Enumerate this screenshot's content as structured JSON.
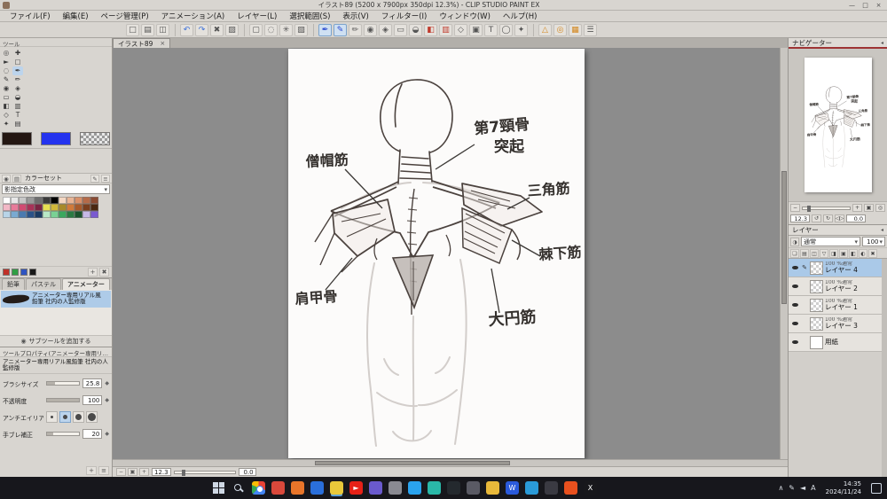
{
  "window": {
    "title": "イラスト89 (5200 x 7900px 350dpi 12.3%) - CLIP STUDIO PAINT EX",
    "minimize": "—",
    "maximize": "□",
    "close": "×"
  },
  "menubar": [
    "ファイル(F)",
    "編集(E)",
    "ページ管理(P)",
    "アニメーション(A)",
    "レイヤー(L)",
    "選択範囲(S)",
    "表示(V)",
    "フィルター(I)",
    "ウィンドウ(W)",
    "ヘルプ(H)"
  ],
  "toolbar": [
    {
      "name": "new-file-icon",
      "glyph": "□",
      "color": "#555555"
    },
    {
      "name": "open-file-icon",
      "glyph": "▤",
      "color": "#555555"
    },
    {
      "name": "save-icon",
      "glyph": "◫",
      "color": "#555555"
    },
    {
      "name": "sep"
    },
    {
      "name": "undo-icon",
      "glyph": "↶",
      "color": "#3a6fd8"
    },
    {
      "name": "redo-icon",
      "glyph": "↷",
      "color": "#3a6fd8"
    },
    {
      "name": "delete-icon",
      "glyph": "✖",
      "color": "#555555"
    },
    {
      "name": "fill-selection-icon",
      "glyph": "▨",
      "color": "#555555"
    },
    {
      "name": "sep"
    },
    {
      "name": "select-rectangle-icon",
      "glyph": "▢",
      "color": "#555555"
    },
    {
      "name": "select-lasso-icon",
      "glyph": "◌",
      "color": "#555555"
    },
    {
      "name": "auto-select-icon",
      "glyph": "✳",
      "color": "#555555"
    },
    {
      "name": "deselect-icon",
      "glyph": "▧",
      "color": "#555555"
    },
    {
      "name": "sep"
    },
    {
      "name": "pen-tool-icon",
      "glyph": "✒",
      "color": "#2a4ad0",
      "active": true
    },
    {
      "name": "pencil-tool-icon",
      "glyph": "✎",
      "color": "#2a4ad0",
      "active": true
    },
    {
      "name": "brush-tool-icon",
      "glyph": "✏",
      "color": "#555555"
    },
    {
      "name": "airbrush-tool-icon",
      "glyph": "◉",
      "color": "#555555"
    },
    {
      "name": "decoration-tool-icon",
      "glyph": "◈",
      "color": "#555555"
    },
    {
      "name": "eraser-tool-icon",
      "glyph": "▭",
      "color": "#555555"
    },
    {
      "name": "blend-tool-icon",
      "glyph": "◒",
      "color": "#555555"
    },
    {
      "name": "fill-tool-icon",
      "glyph": "◧",
      "color": "#c0392b"
    },
    {
      "name": "gradient-tool-icon",
      "glyph": "▥",
      "color": "#c0392b"
    },
    {
      "name": "figure-tool-icon",
      "glyph": "◇",
      "color": "#555555"
    },
    {
      "name": "frame-tool-icon",
      "glyph": "▣",
      "color": "#555555"
    },
    {
      "name": "text-tool-icon",
      "glyph": "T",
      "color": "#555555"
    },
    {
      "name": "balloon-tool-icon",
      "glyph": "◯",
      "color": "#555555"
    },
    {
      "name": "eyedropper-tool-icon",
      "glyph": "✦",
      "color": "#555555"
    },
    {
      "name": "sep"
    },
    {
      "name": "snap-ruler-icon",
      "glyph": "△",
      "color": "#d4881f"
    },
    {
      "name": "snap-special-ruler-icon",
      "glyph": "◎",
      "color": "#d4881f"
    },
    {
      "name": "grid-icon",
      "glyph": "▦",
      "color": "#d4881f"
    },
    {
      "name": "material-palette-icon",
      "glyph": "☰",
      "color": "#555555"
    }
  ],
  "tool_palette": {
    "title": "ツール",
    "tools": [
      {
        "name": "zoom-tool",
        "glyph": "◎"
      },
      {
        "name": "move-tool",
        "glyph": "✚"
      },
      {
        "name": "operation-tool",
        "glyph": "►"
      },
      {
        "name": "selection-tool",
        "glyph": "▢"
      },
      {
        "name": "lasso-tool",
        "glyph": "◌"
      },
      {
        "name": "pen-tool",
        "glyph": "✒",
        "active": true
      },
      {
        "name": "pencil-tool",
        "glyph": "✎"
      },
      {
        "name": "brush-tool",
        "glyph": "✏"
      },
      {
        "name": "airbrush-tool",
        "glyph": "◉"
      },
      {
        "name": "decoration-tool",
        "glyph": "◈"
      },
      {
        "name": "eraser-tool",
        "glyph": "▭"
      },
      {
        "name": "blend-tool",
        "glyph": "◒"
      },
      {
        "name": "fill-tool",
        "glyph": "◧"
      },
      {
        "name": "gradient-tool",
        "glyph": "▥"
      },
      {
        "name": "figure-tool",
        "glyph": "◇"
      },
      {
        "name": "text-tool",
        "glyph": "T"
      },
      {
        "name": "eyedropper-tool",
        "glyph": "✦"
      },
      {
        "name": "lighttable-tool",
        "glyph": "▤"
      }
    ]
  },
  "color_area": {
    "main_color": "#241712",
    "sub_color": "#2433ee"
  },
  "color_set": {
    "tab_label": "カラーセット",
    "preset_name": "影指定色改",
    "dropdown_arrow": "▾",
    "header_icons": [
      {
        "name": "color-wheel-tab-icon",
        "glyph": "◉"
      },
      {
        "name": "color-slider-tab-icon",
        "glyph": "▤"
      }
    ],
    "menu_icons": [
      {
        "name": "edit-colorset-icon",
        "glyph": "✎"
      },
      {
        "name": "colorset-menu-icon",
        "glyph": "≡"
      }
    ],
    "footer_icons": [
      {
        "name": "add-color-icon",
        "glyph": "+"
      },
      {
        "name": "delete-color-icon",
        "glyph": "✖"
      }
    ],
    "colors": [
      "#ffffff",
      "#e8e8e8",
      "#c8c8c8",
      "#9a9a9a",
      "#6e6e6e",
      "#3a3a3a",
      "#000000",
      "#f4d7c2",
      "#e8b495",
      "#d9906a",
      "#b56a48",
      "#8a4a32",
      "#f2b8c6",
      "#e87a9a",
      "#d14a72",
      "#a83258",
      "#7a2442",
      "#e8e052",
      "#d1b83a",
      "#a88a2a",
      "#d17a3a",
      "#a85a2a",
      "#7a3e1e",
      "#4a2812",
      "#b8d4e8",
      "#7aaad1",
      "#4a7ab0",
      "#2a5288",
      "#1a3a62",
      "#b8e8c6",
      "#7ad194",
      "#3aa85e",
      "#2a7a42",
      "#1a522c",
      "#c6b8e8",
      "#7a5ad1"
    ],
    "registered": [
      "#c03028",
      "#2f9e44",
      "#2f54c0",
      "#191919"
    ]
  },
  "subtool": {
    "tabs": [
      {
        "label": "鉛筆"
      },
      {
        "label": "パステル"
      },
      {
        "label": "アニメーター",
        "active": true
      }
    ],
    "items": [
      {
        "name": "アニメーター専用リアル風鉛筆 社内の人監修版",
        "selected": true
      }
    ],
    "add_icon": "◉",
    "add_label": "サブツールを追加する"
  },
  "tool_property": {
    "title": "ツールプロパティ(アニメーター専用リアル風鉛筆 社内の人監修版)",
    "brush_name": "アニメーター専用リアル風鉛筆 社内の人監修版",
    "props": [
      {
        "type": "slider",
        "label": "ブラシサイズ",
        "value": "25.8"
      },
      {
        "type": "slider",
        "label": "不透明度",
        "value": "100"
      },
      {
        "type": "aa",
        "label": "アンチエイリアス"
      },
      {
        "type": "slider",
        "label": "手ブレ補正",
        "value": "20"
      }
    ],
    "footer_icons": [
      {
        "name": "add-to-subtool-icon",
        "glyph": "+"
      },
      {
        "name": "property-settings-icon",
        "glyph": "≡"
      }
    ]
  },
  "document": {
    "tab_title": "イラスト89",
    "close": "×",
    "zoom_value": "12.3",
    "rotate_value": "0.0",
    "status_icons": [
      {
        "name": "zoom-out-button",
        "glyph": "−"
      },
      {
        "name": "zoom-fit-button",
        "glyph": "▣"
      },
      {
        "name": "zoom-in-button",
        "glyph": "+"
      }
    ]
  },
  "drawing_labels": {
    "trapezius": "僧帽筋",
    "c7_line1": "第7頸骨",
    "c7_line2": "突起",
    "deltoid": "三角筋",
    "infraspinatus": "棘下筋",
    "scapula": "肩甲骨",
    "teres_major": "大円筋"
  },
  "navigator": {
    "tab_label": "ナビゲーター",
    "zoom_value": "12.3",
    "rotate_value": "0.0",
    "zoom_icons": [
      {
        "name": "navigator-zoom-out-icon",
        "glyph": "−"
      },
      {
        "name": "navigator-zoom-slider",
        "glyph": ""
      },
      {
        "name": "navigator-zoom-in-icon",
        "glyph": "+"
      },
      {
        "name": "fit-to-window-icon",
        "glyph": "▣"
      },
      {
        "name": "zoom-100-icon",
        "glyph": "◎"
      }
    ],
    "rotate_icons": [
      {
        "name": "rotate-left-icon",
        "glyph": "↺"
      },
      {
        "name": "rotate-right-icon",
        "glyph": "↻"
      },
      {
        "name": "flip-horizontal-icon",
        "glyph": "◁▷"
      }
    ]
  },
  "layer_panel": {
    "tab_label": "レイヤー",
    "blend_mode": "通常",
    "opacity_value": "100",
    "dropdown_arrow": "▾",
    "header_icons": [
      {
        "name": "new-layer-icon",
        "glyph": "❏"
      },
      {
        "name": "new-folder-icon",
        "glyph": "▤"
      },
      {
        "name": "duplicate-layer-icon",
        "glyph": "◫"
      },
      {
        "name": "merge-down-icon",
        "glyph": "▽"
      },
      {
        "name": "clipping-mask-icon",
        "glyph": "◨"
      },
      {
        "name": "lock-layer-icon",
        "glyph": "▣"
      },
      {
        "name": "lock-transparent-icon",
        "glyph": "◧"
      },
      {
        "name": "layer-mask-icon",
        "glyph": "◐"
      },
      {
        "name": "delete-layer-icon",
        "glyph": "✖"
      }
    ],
    "layers": [
      {
        "meta": "100 %通常",
        "name": "レイヤー 4",
        "selected": true
      },
      {
        "meta": "100 %通常",
        "name": "レイヤー 2"
      },
      {
        "meta": "100 %通常",
        "name": "レイヤー 1"
      },
      {
        "meta": "100 %通常",
        "name": "レイヤー 3"
      },
      {
        "meta": "",
        "name": "用紙",
        "paper": true
      }
    ]
  },
  "taskbar": {
    "time": "14:35",
    "date": "2024/11/24",
    "icons": [
      {
        "name": "chrome-icon",
        "color": "chrome"
      },
      {
        "name": "mail-app-icon",
        "color": "#d9483b"
      },
      {
        "name": "firefox-icon",
        "color": "#e8752a"
      },
      {
        "name": "thunderbird-icon",
        "color": "#2a6fdb"
      },
      {
        "name": "clip-studio-paint-icon",
        "color": "#e8c83a",
        "active": true
      },
      {
        "name": "youtube-icon",
        "color": "#e62117",
        "glyph": "►"
      },
      {
        "name": "discord-icon",
        "color": "#6a5acd"
      },
      {
        "name": "steam-icon",
        "color": "#8a8a92"
      },
      {
        "name": "twitter-icon",
        "color": "#2aa3ef"
      },
      {
        "name": "teal-app-icon",
        "color": "#2ab8a8"
      },
      {
        "name": "github-icon",
        "color": "#24292e"
      },
      {
        "name": "contacts-icon",
        "color": "#5a5a64"
      },
      {
        "name": "explorer-icon",
        "color": "#e8b83a"
      },
      {
        "name": "word-icon",
        "color": "#2a5adb",
        "glyph": "W"
      },
      {
        "name": "edge-icon",
        "color": "#2a9ad8"
      },
      {
        "name": "obs-studio-icon",
        "color": "#3a3a42"
      },
      {
        "name": "reddit-icon",
        "color": "#e8501e"
      },
      {
        "name": "x-app-icon",
        "color": "#18181c",
        "glyph": "X"
      }
    ],
    "tray": [
      {
        "name": "tray-expand-icon",
        "glyph": "∧"
      },
      {
        "name": "tray-pen-icon",
        "glyph": "✎"
      },
      {
        "name": "tray-sound-icon",
        "glyph": "◄"
      },
      {
        "name": "tray-ime-icon",
        "glyph": "A"
      }
    ]
  }
}
